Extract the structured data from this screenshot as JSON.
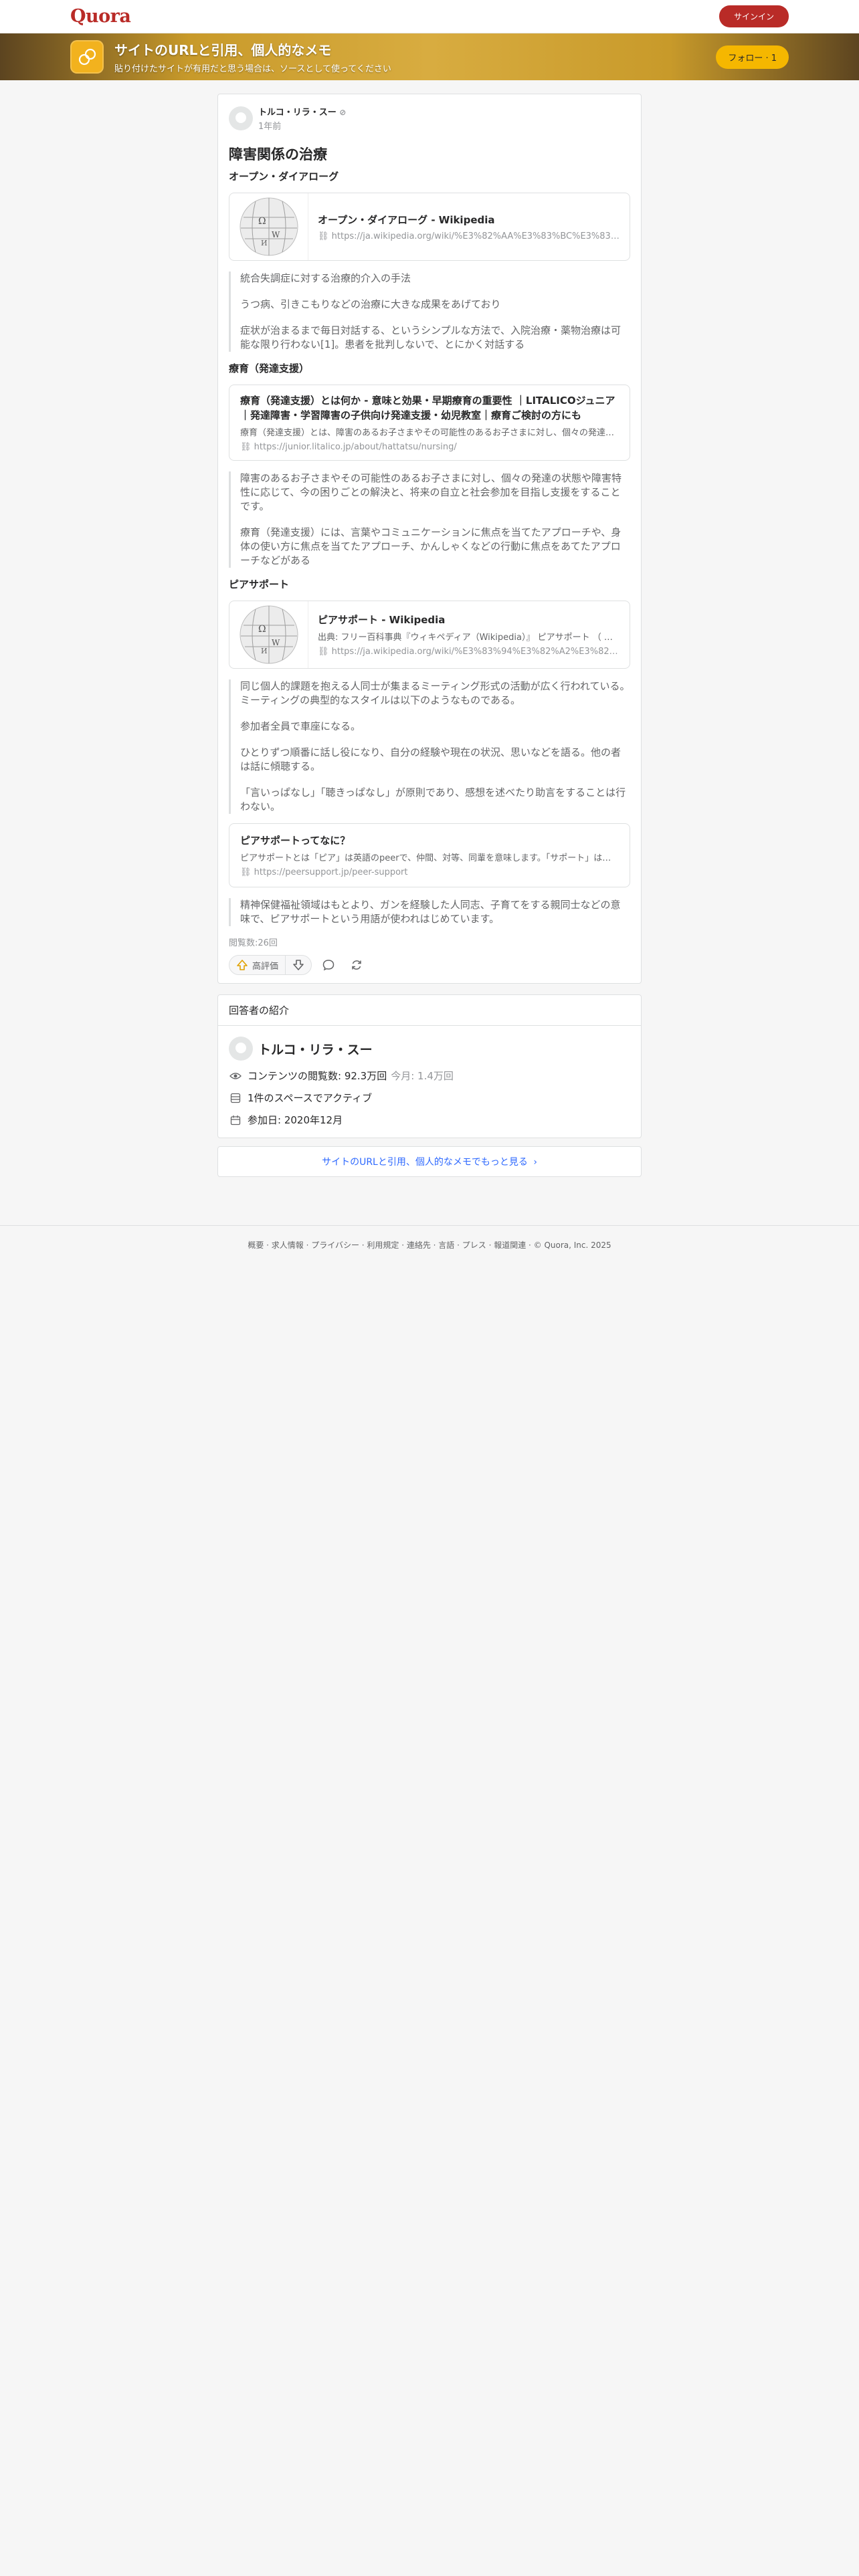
{
  "header": {
    "logo": "Quora",
    "signin_label": "サインイン"
  },
  "space": {
    "title": "サイトのURLと引用、個人的なメモ",
    "subtitle": "貼り付けたサイトが有用だと思う場合は、ソースとして使ってください",
    "follow_label": "フォロー · 1",
    "icon": "space-icon"
  },
  "post": {
    "author_name": "トルコ・リラ・スー",
    "time": "1年前",
    "title": "障害関係の治療",
    "sections": [
      {
        "heading": "オープン・ダイアローグ",
        "link": {
          "title": "オープン・ダイアローグ - Wikipedia",
          "desc": "",
          "url": "https://ja.wikipedia.org/wiki/%E3%82%AA%E3%83%BC%E3%83%97%E3%83%B3%E3%83%BB%E3%83%80%E3%82%A4%E3%82%A2%E3%83%AD%E3%83%BC%E3%82%B0",
          "thumb": "wikipedia-globe"
        },
        "quotes": [
          "統合失調症に対する治療的介入の手法",
          "うつ病、引きこもりなどの治療に大きな成果をあげており",
          "症状が治まるまで毎日対話する、というシンプルな方法で、入院治療・薬物治療は可能な限り行わない[1]。患者を批判しないで、とにかく対話する"
        ]
      },
      {
        "heading": "療育（発達支援）",
        "link": {
          "title": "療育（発達支援）とは何か - 意味と効果・早期療育の重要性 ｜LITALICOジュニア｜発達障害・学習障害の子供向け発達支援・幼児教室｜療育ご検討の方にも",
          "desc": "療育（発達支援）とは、障害のあるお子さまやその可能性のあるお子さまに対し、個々の発達の状態や障害特性に応じて、今の困りごとの解決と、将来の自立と社会参加を目指し支援をすることです。",
          "url": "https://junior.litalico.jp/about/hattatsu/nursing/"
        },
        "quotes": [
          "障害のあるお子さまやその可能性のあるお子さまに対し、個々の発達の状態や障害特性に応じて、今の困りごとの解決と、将来の自立と社会参加を目指し支援をすることです。",
          "療育（発達支援）には、言葉やコミュニケーションに焦点を当てたアプローチや、身体の使い方に焦点を当てたアプローチ、かんしゃくなどの行動に焦点をあてたアプローチなどがある"
        ]
      },
      {
        "heading": "ピアサポート",
        "link": {
          "title": "ピアサポート - Wikipedia",
          "desc": "出典: フリー百科事典『ウィキペディア（Wikipedia）』 ピアサポート （ 英語: peer support ）とは、同じ課題や環境を体験する人がその体験から来る感情を共有することで専門職による支援では得がたい安心感や自己肯定感を得られることを指す。",
          "url": "https://ja.wikipedia.org/wiki/%E3%83%94%E3%82%A2%E3%82%B5%E3%83%9D%E3%83%BC%E3%83%88",
          "thumb": "wikipedia-globe"
        },
        "quotes": [
          "同じ個人的課題を抱える人同士が集まるミーティング形式の活動が広く行われている。ミーティングの典型的なスタイルは以下のようなものである。",
          "参加者全員で車座になる。",
          "ひとりずつ順番に話し役になり、自分の経験や現在の状況、思いなどを語る。他の者は話に傾聴する。",
          "「言いっぱなし」「聴きっぱなし」が原則であり、感想を述べたり助言をすることは行わない。"
        ]
      }
    ],
    "text_card": {
      "title": "ピアサポートってなに？",
      "desc": "ピアサポートとは「ピア」は英語のpeerで、仲間、対等、同輩を意味します。「サポート」は支援という意味です。",
      "url": "https://peersupport.jp/peer-support"
    },
    "final_quote": "精神保健福祉領域はもとより、ガンを経験した人同志、子育てをする親同士などの意味で、ピアサポートという用語が使われはじめています。",
    "views": "閲覧数:26回",
    "upvote_label": "高評価"
  },
  "about": {
    "header": "回答者の紹介",
    "name": "トルコ・リラ・スー",
    "views_label": "コンテンツの閲覧数: 92.3万回",
    "views_month": "今月: 1.4万回",
    "spaces": "1件のスペースでアクティブ",
    "joined": "参加日: 2020年12月"
  },
  "more_link": "サイトのURLと引用、個人的なメモでもっと見る",
  "footer": "概要 · 求人情報 · プライバシー · 利用規定 · 連絡先 · 言語 · プレス · 報道関連 · © Quora, Inc. 2025",
  "colors": {
    "brand": "#b92b27",
    "follow": "#f5b700",
    "link": "#2e69ff"
  }
}
